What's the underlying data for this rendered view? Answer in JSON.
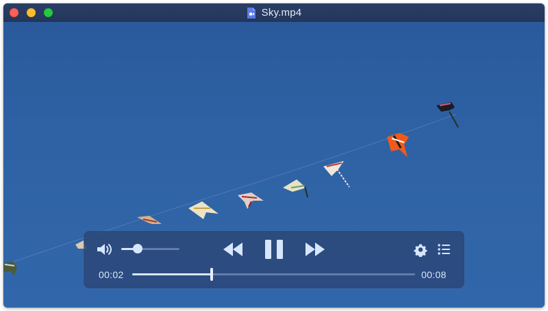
{
  "window": {
    "title": "Sky.mp4",
    "file_icon": "video-file-icon"
  },
  "titlebar": {
    "close": "close-button",
    "minimize": "minimize-button",
    "zoom": "zoom-button"
  },
  "video": {
    "description_icon": "video-frame"
  },
  "controls": {
    "volume_icon": "speaker-icon",
    "volume_level": 0.28,
    "rewind_icon": "rewind-icon",
    "play_state_icon": "pause-icon",
    "fast_forward_icon": "fast-forward-icon",
    "settings_icon": "gear-icon",
    "playlist_icon": "list-icon",
    "current_time": "00:02",
    "duration": "00:08",
    "progress": 0.28
  },
  "colors": {
    "accent": "#d7e6ff",
    "sky": "#2e62a4",
    "titlebar": "#23365a"
  }
}
